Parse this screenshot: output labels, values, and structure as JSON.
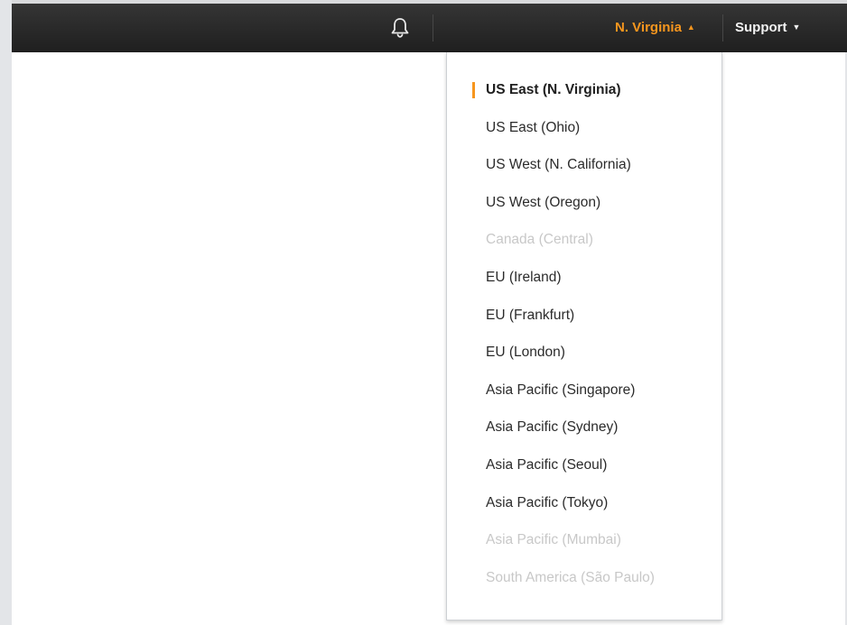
{
  "navbar": {
    "notifications_icon": "bell-icon",
    "region_label": "N. Virginia",
    "region_caret": "▲",
    "support_label": "Support",
    "support_caret": "▼"
  },
  "colors": {
    "navbar_bg": "#262626",
    "accent": "#f7961e",
    "disabled_text": "#c8c8c8"
  },
  "region_menu": {
    "items": [
      {
        "label": "US East (N. Virginia)",
        "selected": true,
        "enabled": true
      },
      {
        "label": "US East (Ohio)",
        "selected": false,
        "enabled": true
      },
      {
        "label": "US West (N. California)",
        "selected": false,
        "enabled": true
      },
      {
        "label": "US West (Oregon)",
        "selected": false,
        "enabled": true
      },
      {
        "label": "Canada (Central)",
        "selected": false,
        "enabled": false
      },
      {
        "label": "EU (Ireland)",
        "selected": false,
        "enabled": true
      },
      {
        "label": "EU (Frankfurt)",
        "selected": false,
        "enabled": true
      },
      {
        "label": "EU (London)",
        "selected": false,
        "enabled": true
      },
      {
        "label": "Asia Pacific (Singapore)",
        "selected": false,
        "enabled": true
      },
      {
        "label": "Asia Pacific (Sydney)",
        "selected": false,
        "enabled": true
      },
      {
        "label": "Asia Pacific (Seoul)",
        "selected": false,
        "enabled": true
      },
      {
        "label": "Asia Pacific (Tokyo)",
        "selected": false,
        "enabled": true
      },
      {
        "label": "Asia Pacific (Mumbai)",
        "selected": false,
        "enabled": false
      },
      {
        "label": "South America (São Paulo)",
        "selected": false,
        "enabled": false
      }
    ]
  }
}
